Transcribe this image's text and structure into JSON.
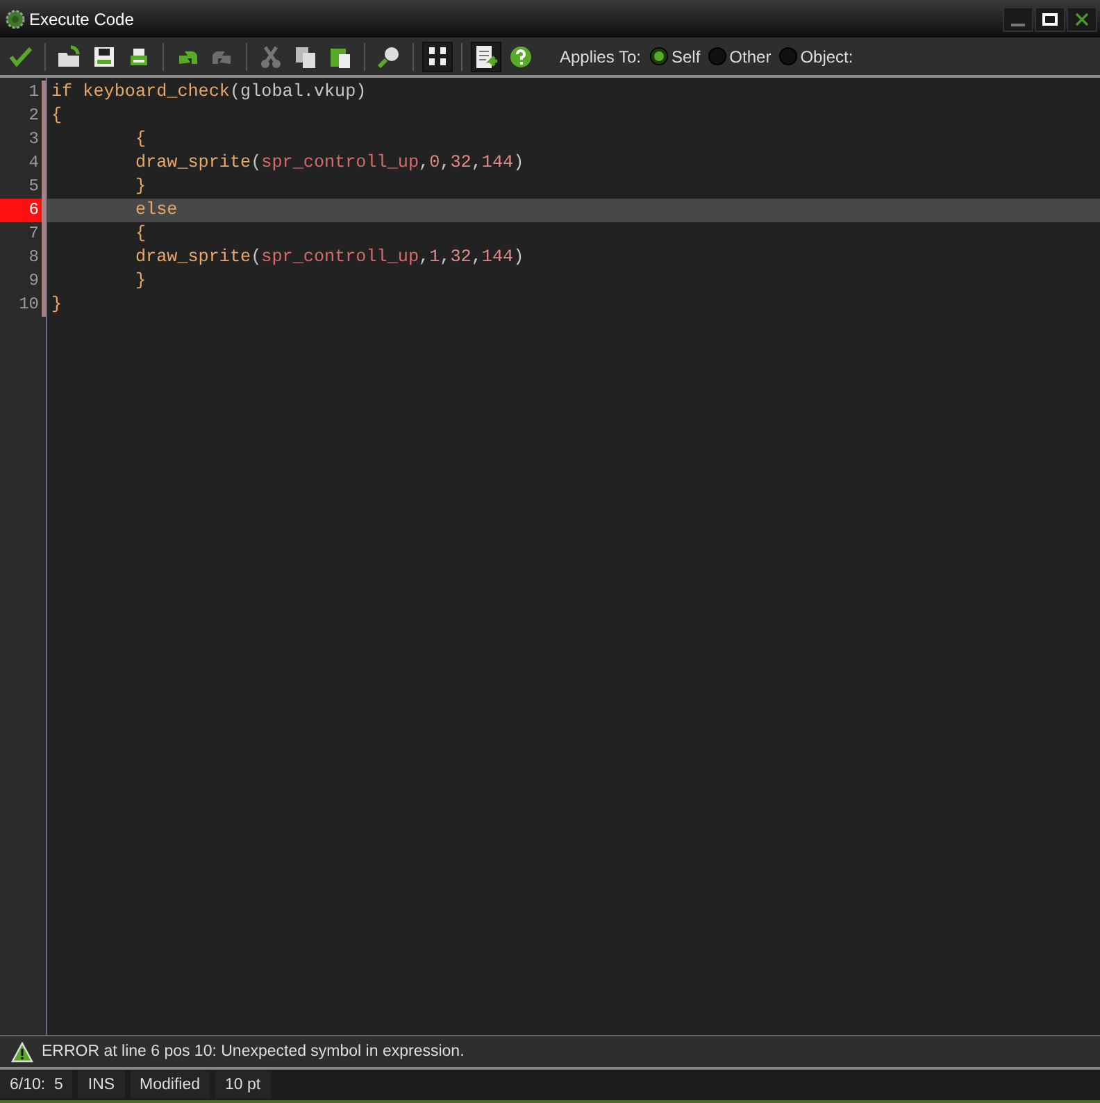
{
  "window": {
    "title": "Execute Code"
  },
  "toolbar": [
    {
      "kind": "check",
      "disabled": false
    },
    {
      "kind": "sep"
    },
    {
      "kind": "open",
      "disabled": false
    },
    {
      "kind": "save",
      "disabled": false
    },
    {
      "kind": "print",
      "disabled": false
    },
    {
      "kind": "sep"
    },
    {
      "kind": "undo",
      "disabled": false
    },
    {
      "kind": "redo",
      "disabled": true
    },
    {
      "kind": "sep"
    },
    {
      "kind": "cut",
      "disabled": true
    },
    {
      "kind": "copy",
      "disabled": false
    },
    {
      "kind": "paste",
      "disabled": false
    },
    {
      "kind": "sep"
    },
    {
      "kind": "find",
      "disabled": false
    },
    {
      "kind": "sep"
    },
    {
      "kind": "goto",
      "disabled": false
    },
    {
      "kind": "sep"
    },
    {
      "kind": "insert",
      "disabled": false
    },
    {
      "kind": "help",
      "disabled": false
    }
  ],
  "applies_to": {
    "label": "Applies To:",
    "options": [
      {
        "label": "Self",
        "selected": true
      },
      {
        "label": "Other",
        "selected": false
      },
      {
        "label": "Object:",
        "selected": false
      }
    ]
  },
  "code": [
    {
      "number": "1",
      "error": false,
      "tokens": [
        {
          "kind": "kw",
          "text": "if keyboard_check"
        },
        {
          "kind": "plain",
          "text": "(global.vkup)"
        }
      ]
    },
    {
      "number": "2",
      "error": false,
      "tokens": [
        {
          "kind": "kw",
          "text": "{"
        }
      ]
    },
    {
      "number": "3",
      "error": false,
      "tokens": [
        {
          "kind": "kw",
          "text": "        {"
        }
      ]
    },
    {
      "number": "4",
      "error": false,
      "tokens": [
        {
          "kind": "kw",
          "text": "        draw_sprite"
        },
        {
          "kind": "plain",
          "text": "("
        },
        {
          "kind": "res",
          "text": "spr_controll_up"
        },
        {
          "kind": "plain",
          "text": ","
        },
        {
          "kind": "num",
          "text": "0"
        },
        {
          "kind": "plain",
          "text": ","
        },
        {
          "kind": "num",
          "text": "32"
        },
        {
          "kind": "plain",
          "text": ","
        },
        {
          "kind": "num",
          "text": "144"
        },
        {
          "kind": "plain",
          "text": ")"
        }
      ]
    },
    {
      "number": "5",
      "error": false,
      "tokens": [
        {
          "kind": "kw",
          "text": "        }"
        }
      ]
    },
    {
      "number": "6",
      "error": true,
      "tokens": [
        {
          "kind": "kw",
          "text": "        else"
        }
      ]
    },
    {
      "number": "7",
      "error": false,
      "tokens": [
        {
          "kind": "kw",
          "text": "        {"
        }
      ]
    },
    {
      "number": "8",
      "error": false,
      "tokens": [
        {
          "kind": "kw",
          "text": "        draw_sprite"
        },
        {
          "kind": "plain",
          "text": "("
        },
        {
          "kind": "res",
          "text": "spr_controll_up"
        },
        {
          "kind": "plain",
          "text": ","
        },
        {
          "kind": "num",
          "text": "1"
        },
        {
          "kind": "plain",
          "text": ","
        },
        {
          "kind": "num",
          "text": "32"
        },
        {
          "kind": "plain",
          "text": ","
        },
        {
          "kind": "num",
          "text": "144"
        },
        {
          "kind": "plain",
          "text": ")"
        }
      ]
    },
    {
      "number": "9",
      "error": false,
      "tokens": [
        {
          "kind": "kw",
          "text": "        }"
        }
      ]
    },
    {
      "number": "10",
      "error": false,
      "tokens": [
        {
          "kind": "kw",
          "text": "}"
        }
      ]
    }
  ],
  "message": "ERROR at line 6 pos 10: Unexpected symbol in expression.",
  "status_bar": [
    "6/10:  5",
    "INS",
    "Modified",
    "10 pt"
  ]
}
